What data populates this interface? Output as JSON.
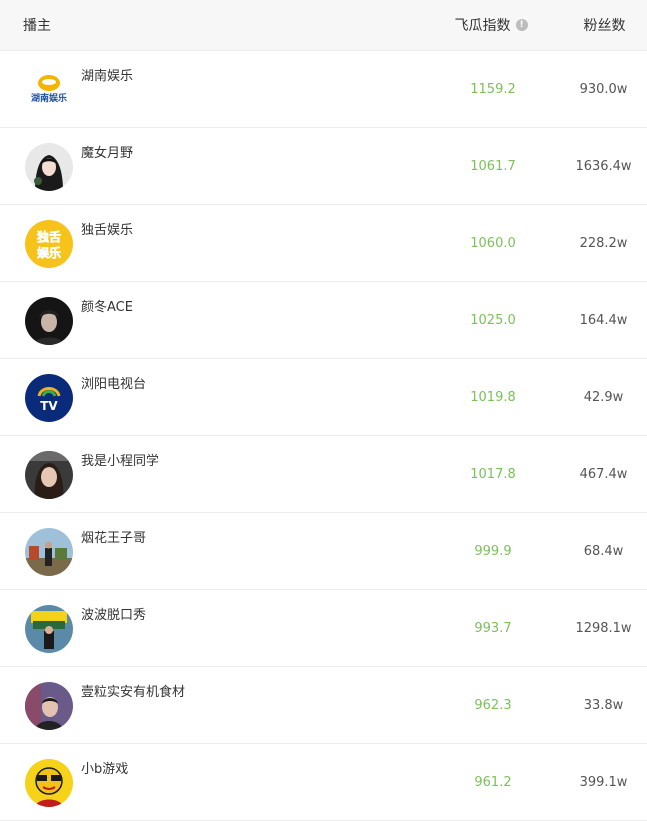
{
  "header": {
    "anchor_label": "播主",
    "index_label": "飞瓜指数",
    "fans_label": "粉丝数"
  },
  "colors": {
    "index_value": "#7cc05a",
    "header_bg": "#f7f7f7",
    "divider": "#ececec"
  },
  "rows": [
    {
      "name": "湖南娱乐",
      "index": "1159.2",
      "fans": "930.0w",
      "avatar_logo_text": "湖南娱乐"
    },
    {
      "name": "魔女月野",
      "index": "1061.7",
      "fans": "1636.4w"
    },
    {
      "name": "独舌娱乐",
      "index": "1060.0",
      "fans": "228.2w",
      "avatar_logo_text": "独舌娱乐"
    },
    {
      "name": "颜冬ACE",
      "index": "1025.0",
      "fans": "164.4w"
    },
    {
      "name": "浏阳电视台",
      "index": "1019.8",
      "fans": "42.9w",
      "avatar_logo_text": "TV"
    },
    {
      "name": "我是小程同学",
      "index": "1017.8",
      "fans": "467.4w"
    },
    {
      "name": "烟花王子哥",
      "index": "999.9",
      "fans": "68.4w"
    },
    {
      "name": "波波脱口秀",
      "index": "993.7",
      "fans": "1298.1w"
    },
    {
      "name": "壹粒实安有机食材",
      "index": "962.3",
      "fans": "33.8w"
    },
    {
      "name": "小b游戏",
      "index": "961.2",
      "fans": "399.1w"
    }
  ]
}
